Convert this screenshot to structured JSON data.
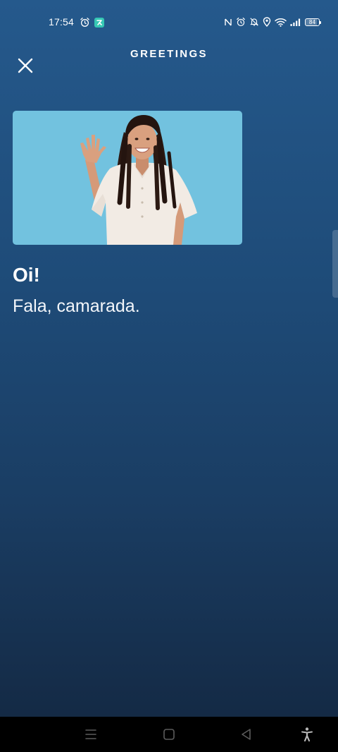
{
  "status_bar": {
    "time": "17:54",
    "battery": "84",
    "icons_left": [
      "alarm-icon",
      "app-notification-icon"
    ],
    "icons_right": [
      "nfc-icon",
      "alarm-icon",
      "mute-icon",
      "location-icon",
      "wifi-icon",
      "signal-icon",
      "battery-icon"
    ]
  },
  "header": {
    "title": "GREETINGS",
    "close_icon": "close-icon"
  },
  "card": {
    "image": "person-waving-illustration",
    "phrase": "Oi!",
    "translation": "Fala, camarada."
  },
  "nav_bar": {
    "icons": [
      "menu-icon",
      "home-icon",
      "back-icon",
      "accessibility-icon"
    ]
  },
  "colors": {
    "background_top": "#25598c",
    "background_bottom": "#142a45",
    "image_background": "#72c2df",
    "app_badge": "#36c8b4",
    "nav_bar": "#000000"
  }
}
